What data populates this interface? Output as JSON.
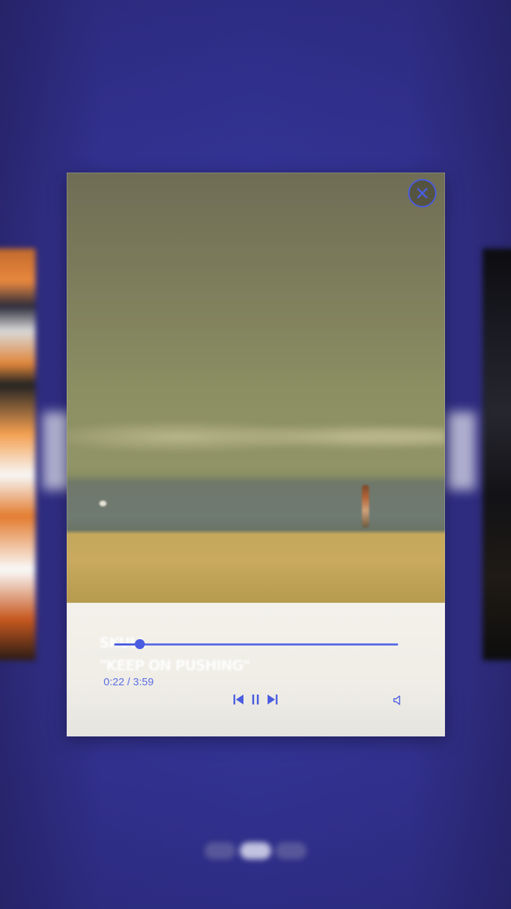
{
  "player": {
    "close_label": "Close",
    "watermark_line1": "SKULL",
    "watermark_line2": "\"KEEP ON PUSHING\"",
    "progress_fraction": 0.09,
    "current_time": "0:22",
    "separator": "/",
    "total_time": "3:59",
    "controls": {
      "prev_icon": "skip-previous-icon",
      "pause_icon": "pause-icon",
      "next_icon": "skip-next-icon",
      "volume_icon": "volume-icon"
    },
    "accent_color": "#4a5ce0"
  },
  "pager": {
    "count": 3,
    "active_index": 1
  }
}
